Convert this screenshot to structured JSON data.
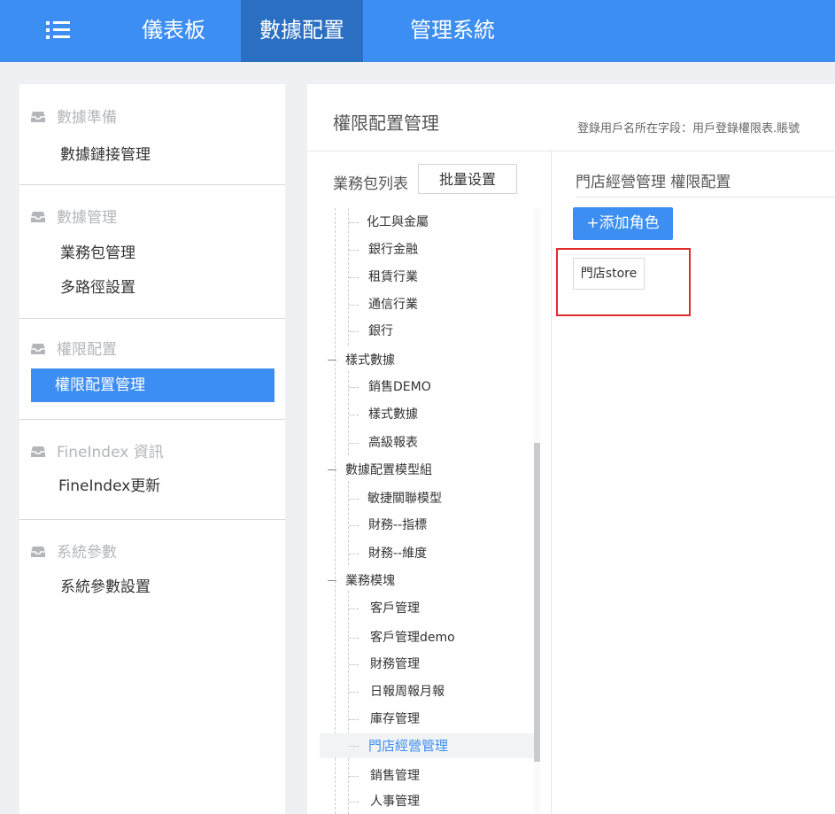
{
  "nav": {
    "tabs": [
      {
        "label": "儀表板"
      },
      {
        "label": "數據配置"
      },
      {
        "label": "管理系統"
      }
    ]
  },
  "sidebar": {
    "sections": [
      {
        "title": "數據準備",
        "items": [
          "數據鏈接管理"
        ]
      },
      {
        "title": "數據管理",
        "items": [
          "業務包管理",
          "多路徑設置"
        ]
      },
      {
        "title": "權限配置",
        "items": [
          "權限配置管理"
        ]
      },
      {
        "title": "FineIndex 資訊",
        "items": [
          "FineIndex更新"
        ]
      },
      {
        "title": "系統參數",
        "items": [
          "系統參數設置"
        ]
      }
    ]
  },
  "main": {
    "title": "權限配置管理",
    "hint": "登錄用戶名所在字段：用戶登錄權限表.賬號",
    "list_label": "業務包列表",
    "batch_button": "批量设置",
    "tree": [
      "化工與金屬",
      "銀行金融",
      "租賃行業",
      "通信行業",
      "銀行",
      "樣式數據",
      "銷售DEMO",
      "樣式數據",
      "高級報表",
      "數據配置模型組",
      "敏捷關聯模型",
      "財務--指標",
      "財務--維度",
      "業務模塊",
      "客戶管理",
      "客戶管理demo",
      "財務管理",
      "日報周報月報",
      "庫存管理",
      "門店經營管理",
      "銷售管理",
      "人事管理"
    ]
  },
  "detail": {
    "title": "門店經營管理 權限配置",
    "add_role_button": "+添加角色",
    "roles": [
      "門店store"
    ]
  },
  "colors": {
    "accent": "#3d8ef2",
    "nav_active": "#2a6fc2",
    "highlight": "#e02c2c"
  }
}
